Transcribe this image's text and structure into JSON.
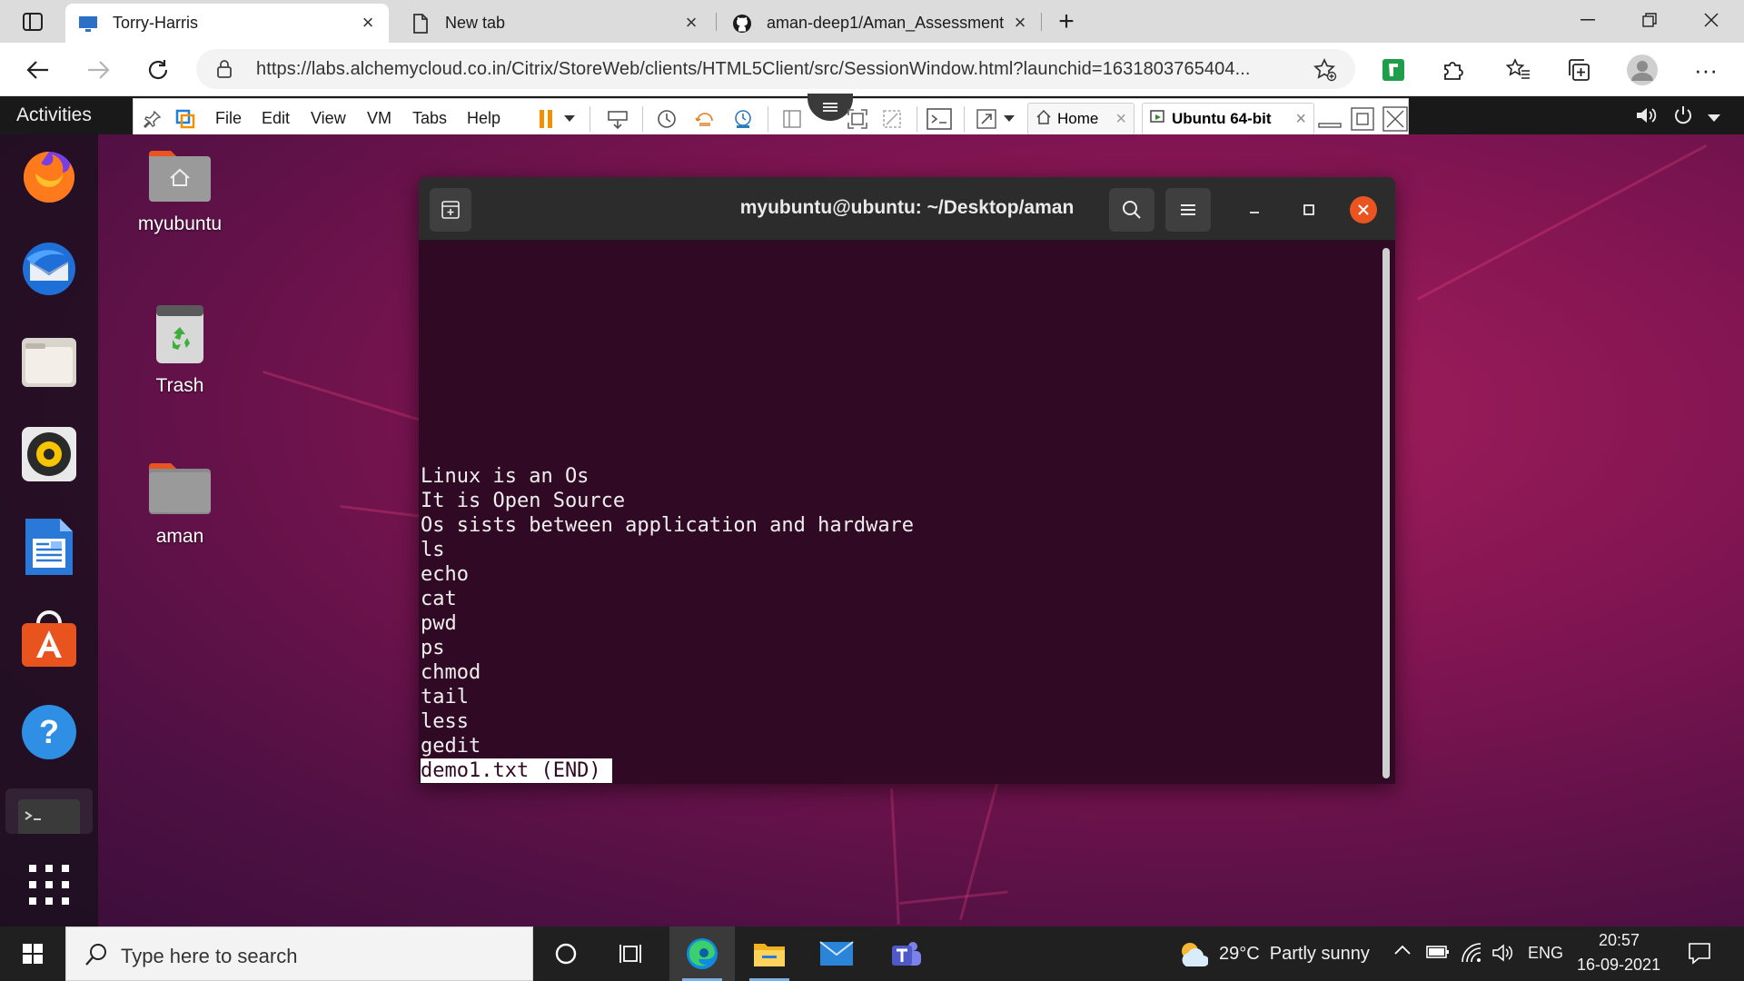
{
  "browser": {
    "tabs": [
      {
        "title": "Torry-Harris",
        "icon": "monitor-icon",
        "active": true
      },
      {
        "title": "New tab",
        "icon": "page-icon",
        "active": false
      },
      {
        "title": "aman-deep1/Aman_Assessment",
        "icon": "github-icon",
        "active": false
      }
    ],
    "url": "https://labs.alchemycloud.co.in/Citrix/StoreWeb/clients/HTML5Client/src/SessionWindow.html?launchid=1631803765404..."
  },
  "ubuntu_panel": {
    "activities_label": "Activities"
  },
  "vm_toolbar": {
    "menus": [
      "File",
      "Edit",
      "View",
      "VM",
      "Tabs",
      "Help"
    ],
    "home_tab": "Home",
    "vm_tab": "Ubuntu 64-bit"
  },
  "desktop": {
    "icons": [
      {
        "label": "myubuntu"
      },
      {
        "label": "Trash"
      },
      {
        "label": "aman"
      }
    ]
  },
  "terminal": {
    "title": "myubuntu@ubuntu: ~/Desktop/aman",
    "lines": [
      "Linux is an Os",
      "It is Open Source",
      "Os sists between application and hardware",
      "ls",
      "echo",
      "cat",
      "pwd",
      "ps",
      "chmod",
      "tail",
      "less",
      "gedit"
    ],
    "status_line": "demo1.txt (END)"
  },
  "taskbar": {
    "search_placeholder": "Type here to search",
    "weather": "29°C  Partly sunny",
    "language": "ENG",
    "time": "20:57",
    "date": "16-09-2021"
  },
  "colors": {
    "terminal_bg": "#300a24",
    "ubuntu_orange": "#e95420",
    "taskbar_bg": "#202020"
  }
}
